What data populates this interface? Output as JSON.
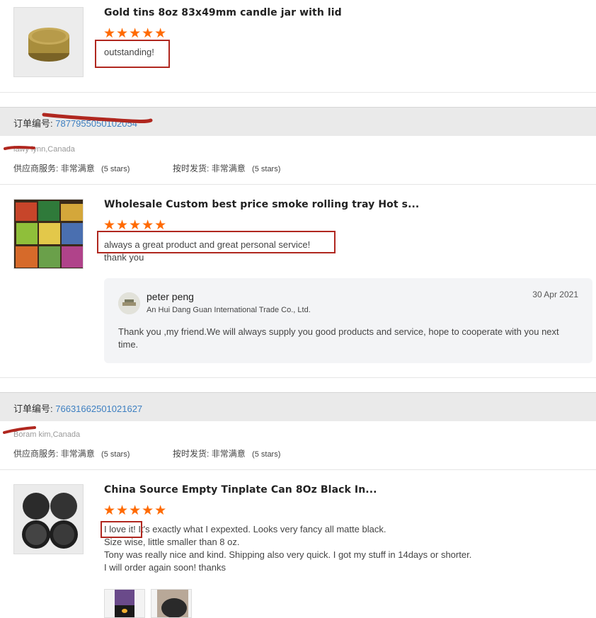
{
  "review1": {
    "title": "Gold tins 8oz 83x49mm candle jar with lid",
    "stars": "★★★★★",
    "text": "outstanding!"
  },
  "order1": {
    "label": "订单编号:",
    "number": "7877955050102054",
    "buyer": "lawy lynn,Canada",
    "supplier_label": "供应商服务:",
    "supplier_value": "非常满意",
    "supplier_stars": "(5 stars)",
    "ontime_label": "按时发货:",
    "ontime_value": "非常满意",
    "ontime_stars": "(5 stars)"
  },
  "review2": {
    "title": "Wholesale Custom best price smoke rolling tray Hot s...",
    "stars": "★★★★★",
    "text_line1": "always a great product and great personal service!",
    "text_line2": "thank you",
    "reply": {
      "name": "peter peng",
      "company": "An Hui Dang Guan International Trade Co., Ltd.",
      "date": "30 Apr 2021",
      "text": "Thank you ,my friend.We will always supply you good products and service, hope to cooperate with you next time."
    }
  },
  "order2": {
    "label": "订单编号:",
    "number": "76631662501021627",
    "buyer": "Boram kim,Canada",
    "supplier_label": "供应商服务:",
    "supplier_value": "非常满意",
    "supplier_stars": "(5 stars)",
    "ontime_label": "按时发货:",
    "ontime_value": "非常满意",
    "ontime_stars": "(5 stars)"
  },
  "review3": {
    "title": "China Source Empty Tinplate Can 8Oz Black In...",
    "stars": "★★★★★",
    "line1a": "I love it!",
    "line1b": " It's exactly what I expexted. Looks very fancy all matte black.",
    "line2": "Size wise, little smaller than 8 oz.",
    "line3": "Tony was really nice and kind. Shipping also very quick. I got my stuff in 14days or shorter.",
    "line4": "I will order again soon! thanks"
  },
  "colors": {
    "accent": "#ff6a00",
    "link": "#3d7fc1",
    "annotation": "#b0271f"
  }
}
